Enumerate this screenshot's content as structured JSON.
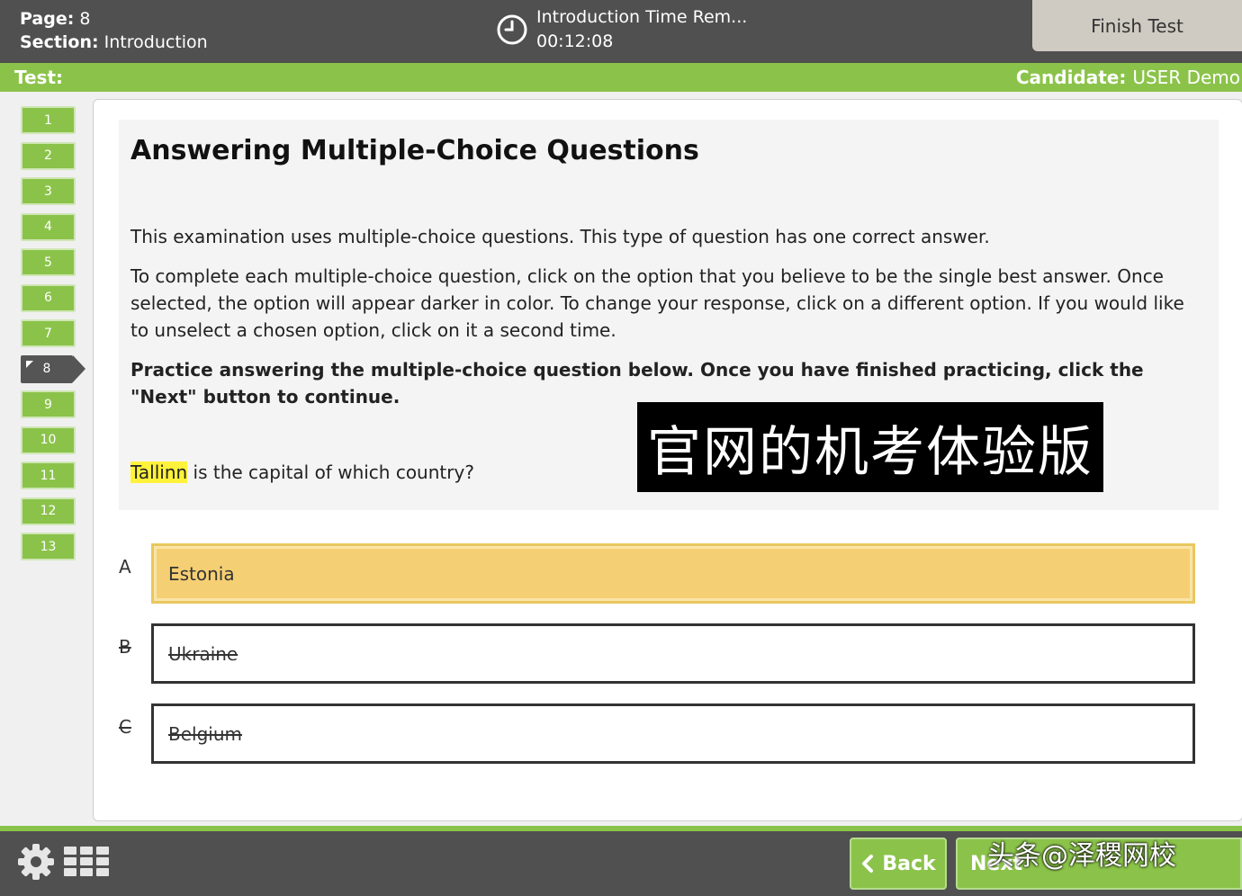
{
  "header": {
    "page_label": "Page:",
    "page_value": "8",
    "section_label": "Section:",
    "section_value": "Introduction",
    "timer_title": "Introduction Time Rem...",
    "timer_value": "00:12:08",
    "finish_button": "Finish Test"
  },
  "subheader": {
    "test_label": "Test:",
    "candidate_label": "Candidate:",
    "candidate_value": "USER Demo"
  },
  "nav": {
    "items": [
      "1",
      "2",
      "3",
      "4",
      "5",
      "6",
      "7",
      "8",
      "9",
      "10",
      "11",
      "12",
      "13"
    ],
    "current": "8"
  },
  "content": {
    "title": "Answering Multiple-Choice Questions",
    "paragraph1": "This examination uses multiple-choice questions. This type of question has one correct answer.",
    "paragraph2": "To complete each multiple-choice question, click on the option that you believe to be the single best answer. Once selected, the option will appear darker in color. To change your response, click on a different option. If you would like to unselect a chosen option, click on it a second time.",
    "paragraph3": "Practice answering the multiple-choice question below. Once you have finished practicing, click the \"Next\" button to continue.",
    "question_highlight": "Tallinn",
    "question_rest": " is the capital of which country?",
    "overlay_caption": "官网的机考体验版"
  },
  "options": [
    {
      "letter": "A",
      "text": "Estonia",
      "state": "selected"
    },
    {
      "letter": "B",
      "text": "Ukraine",
      "state": "struck"
    },
    {
      "letter": "C",
      "text": "Belgium",
      "state": "struck"
    }
  ],
  "footer": {
    "back_button": "Back",
    "next_button": "Next",
    "watermark": "头条@泽稷网校"
  },
  "colors": {
    "accent_green": "#8bc34a",
    "bar_gray": "#505050",
    "selected_option": "#f5cf73",
    "highlight": "#fff23a"
  },
  "icons": [
    "clock-icon",
    "gear-icon",
    "grid-icon",
    "chevron-left-icon",
    "bookmark-flag-icon"
  ]
}
